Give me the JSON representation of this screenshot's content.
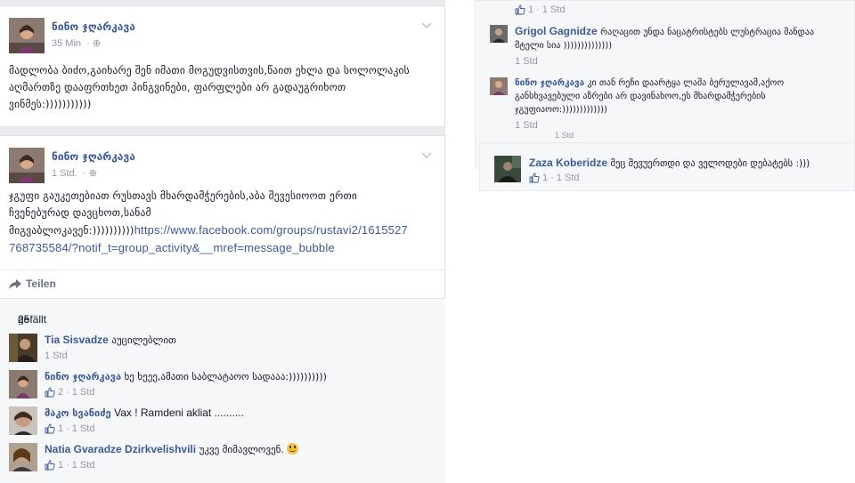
{
  "post1": {
    "author": "ნინო ჯღარკავა",
    "time": "35 Min",
    "text": "მადლობა ბიძო,გაიხარე შენ იმათი მოგუდვისთვის,წაით ეხლა და სოლოლაკის აღმართზე დააფრთხეთ პინგვინები, ფარფლები არ გადაუგრიხოთ ვინმეს:)))))))))))"
  },
  "post2": {
    "author": "ნინო ჯღარკავა",
    "time": "1 Std.",
    "text_line1": "ჯგუფი გაუკეთებიათ რუსთავს მხარდამჭერების,აბა შევესიოოთ ერთი",
    "text_line2": "ჩვენებურად დავცხოთ,სანამ",
    "text_line3_prefix": "მიგვაბლოკავენ:))))))))))",
    "link_part1": "https://www.facebook.com/groups/rustavi2/1615527",
    "link_part2": "768735584/?notif_t=group_activity&__mref=message_bubble",
    "share_label": "Teilen",
    "likes_link": "25 Personen",
    "likes_suffix": " gefällt das."
  },
  "comments": [
    {
      "name": "Tia Sisvadze",
      "text": "აუცილებლით",
      "likes": "",
      "time": "1 Std"
    },
    {
      "name": "ნინო ჯღარკავა",
      "text": "ხე ხეეე,ამათი საბლატაოო სადააა:))))))))))",
      "likes": "2",
      "time": "1 Std"
    },
    {
      "name": "მაკო სვანიძე",
      "text": "Vax ! Ramdeni akliat ..........",
      "likes": "1",
      "time": "1 Std"
    },
    {
      "name": "Natia Gvaradze Dzirkvelishvili",
      "text": "უკვე მიმავლოვენ.",
      "likes": "1",
      "time": "1 Std"
    }
  ],
  "right": {
    "top_meta": {
      "likes": "1",
      "time": "1 Std"
    },
    "comments": [
      {
        "name": "Grigol Gagnidze",
        "text_line1": "რაღაცით უნდა ნაცატრისტებს ლუსტრაცია მანდაა",
        "text_line2": "მტელი სია ))))))))))))))",
        "time": "1 Std"
      },
      {
        "name": "ნინო ჯღარკავა",
        "text_line1": "კი თან რეჩი დაარტყა ლაშა ბერულავამ,აქოო",
        "text_line2": "განსხვავებული აზრები არ დავინახოო,ეს მხარდამჭერების",
        "text_line3": "ჯგუფიაოო:)))))))))))))",
        "time": "1 Std"
      },
      {
        "name": "Zaza Koberidze",
        "text": "მეც შევუერთდი და ველოდები დებატებს :)))",
        "likes": "1",
        "time": "1 Std"
      }
    ],
    "overlap_time": "1 Std"
  },
  "colors": {
    "link": "#3b5998",
    "meta": "#9197a3",
    "bg": "#e9ebee",
    "comment_bg": "#f6f7f9"
  }
}
